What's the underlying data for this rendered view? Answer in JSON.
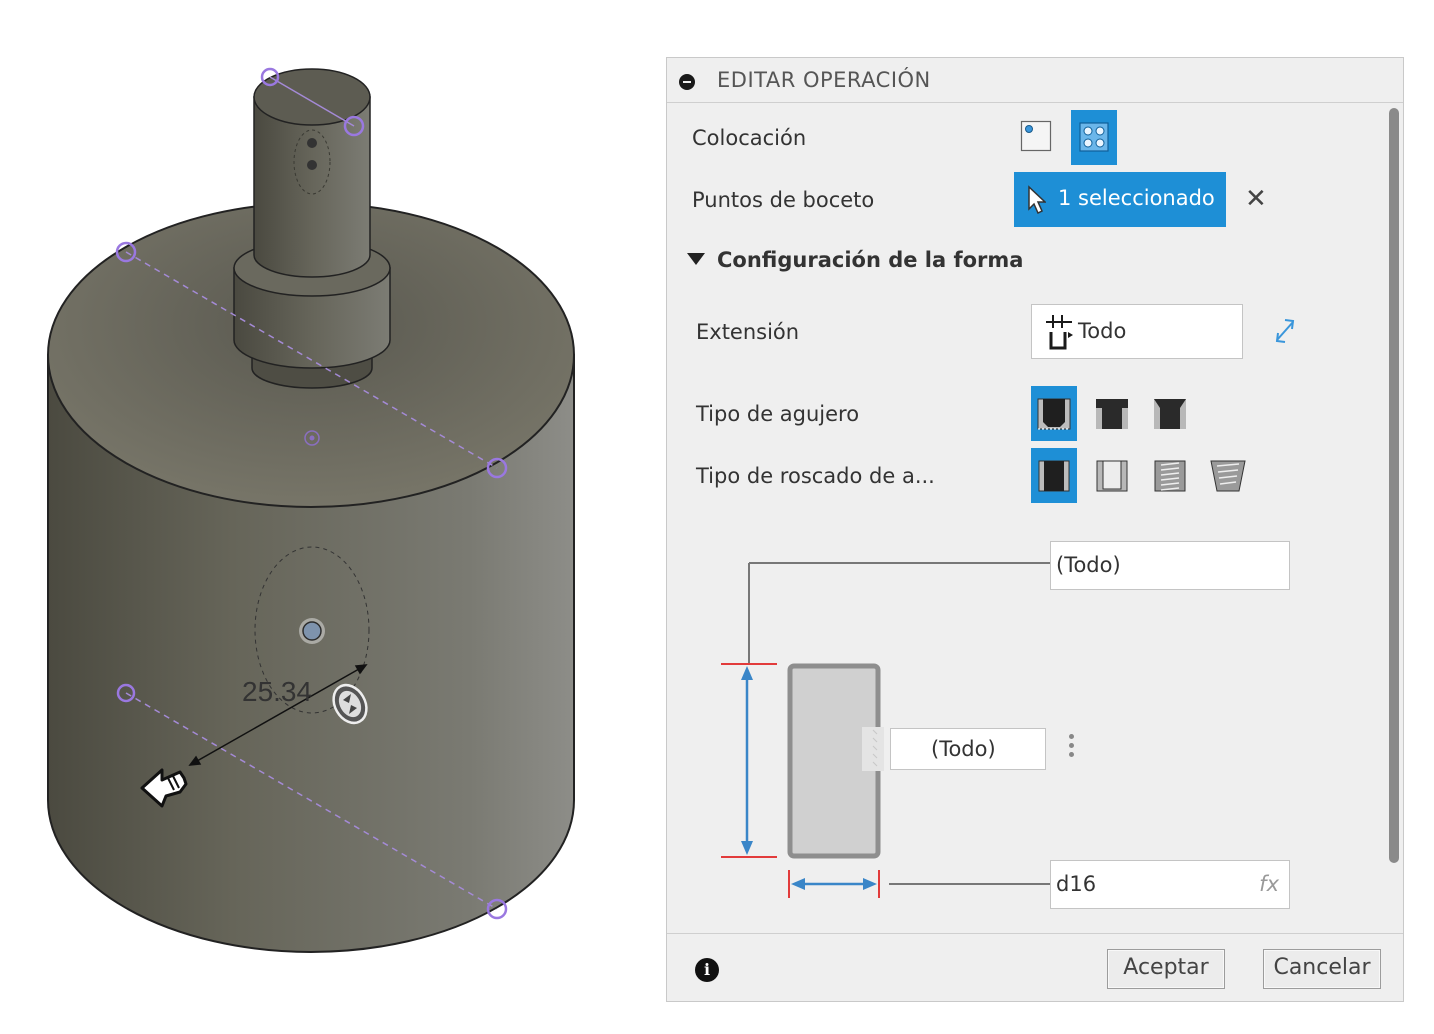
{
  "viewport": {
    "dimension_value": "25.34",
    "body_color": "#6b6a60"
  },
  "panel": {
    "title": "EDITAR OPERACIÓN",
    "placement": {
      "label": "Colocación",
      "options": [
        "single-point-icon",
        "multi-point-icon"
      ],
      "selected": "multi-point-icon"
    },
    "sketch_points": {
      "label": "Puntos de boceto",
      "value": "1 seleccionado",
      "clear_icon": "close-icon"
    },
    "shape_settings": {
      "label": "Configuración de la forma",
      "expanded": true
    },
    "extent": {
      "label": "Extensión",
      "value": "Todo",
      "flip_icon": "flip-direction-icon"
    },
    "hole_type": {
      "label": "Tipo de agujero",
      "options": [
        "simple-hole-icon",
        "counterbore-icon",
        "countersink-icon"
      ],
      "selected": "simple-hole-icon"
    },
    "tap_type": {
      "label": "Tipo de roscado de a...",
      "options": [
        "simple-tap-icon",
        "clearance-tap-icon",
        "tapped-icon",
        "taper-tapped-icon"
      ],
      "selected": "simple-tap-icon"
    },
    "diagram": {
      "top_field": "(Todo)",
      "middle_field": "(Todo)",
      "diameter_field": "d16",
      "fx_label": "fx"
    },
    "footer": {
      "ok_label": "Aceptar",
      "cancel_label": "Cancelar"
    },
    "accent_color": "#1e8fd6"
  }
}
